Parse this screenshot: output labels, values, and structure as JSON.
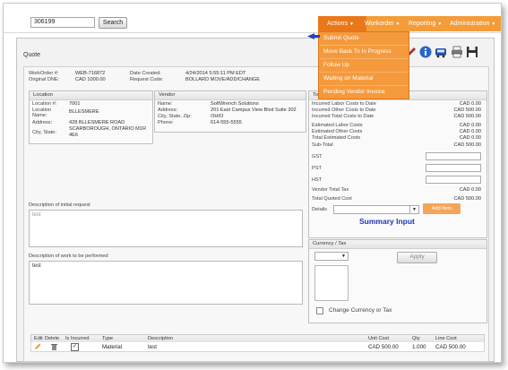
{
  "search": {
    "value": "306199",
    "button": "Search"
  },
  "menubar": {
    "items": [
      {
        "label": "Actions"
      },
      {
        "label": "Workorder"
      },
      {
        "label": "Reporting"
      },
      {
        "label": "Administration"
      }
    ]
  },
  "dropdown": {
    "items": [
      "Submit Quote",
      "Move Back To In Progress",
      "Follow Up",
      "Waiting on Material",
      "Pending Vendor Invoice"
    ]
  },
  "panel": {
    "title": "Quote"
  },
  "header": {
    "workorder_label": "WorkOrder #:",
    "workorder_value": "WEB-716872",
    "original_nte_label": "Original DNE:",
    "original_nte_value": "CAD 1000.00",
    "date_created_label": "Date Created:",
    "date_created_value": "4/24/2014 5:55:11 PM EDT",
    "request_code_label": "Request Code:",
    "request_code_value": "BOLLARD MOVE/ADD/CHANGE",
    "extra_1": "D",
    "extra_2": "D"
  },
  "location": {
    "title": "Location",
    "number_label": "Location #:",
    "number_value": "7001",
    "name_label": "Location Name:",
    "name_label_1": "Location",
    "name_label_2": "Name:",
    "name_value": "BLLESMERE",
    "address_label": "Address:",
    "address_value": "428 BLLESMERE ROAD",
    "city_label": "City, State:",
    "city_value_1": "SCARBOROUGH, ONTARIO M1R",
    "city_value_2": "4E6"
  },
  "vendor": {
    "title": "Vendor",
    "name_label": "Name:",
    "name_value": "SoftWrench Solutions",
    "address_label": "Address:",
    "address_value": "201 East Campus View Blvd Suite 302",
    "city_label": "City, State, Zip:",
    "city_value": "OHIO",
    "phone_label": "Phone:",
    "phone_value": "614-555-5555"
  },
  "totals": {
    "title": "Totals",
    "rows": [
      {
        "label": "Incurred Labor Costs to Date",
        "value": "CAD 0.00"
      },
      {
        "label": "Incurred Other Costs to Date",
        "value": "CAD 500.00"
      },
      {
        "label": "Incurred Total Costs to Date",
        "value": "CAD 500.00"
      },
      {
        "label": "Estimated Labor Costs",
        "value": "CAD 0.00"
      },
      {
        "label": "Estimated Other Costs",
        "value": "CAD 0.00"
      },
      {
        "label": "Total Estimated Costs",
        "value": "CAD 0.00"
      },
      {
        "label": "Sub-Total",
        "value": "CAD 500.00"
      }
    ],
    "gst_label": "GST",
    "pst_label": "PST",
    "hst_label": "HST",
    "vendor_tax_label": "Vendor Total Tax",
    "vendor_tax_value": "CAD 0.00",
    "total_quoted_label": "Total Quoted Cost",
    "total_quoted_value": "CAD 500.00",
    "details_label": "Details",
    "add_button": "Add Item"
  },
  "annotation": {
    "summary_input": "Summary Input"
  },
  "currency": {
    "title": "Currency / Tax",
    "apply_button": "Apply",
    "change_label": "Change Currency or Tax"
  },
  "initial_request": {
    "label": "Description of initial request",
    "value": "test"
  },
  "work_performed": {
    "label": "Description of work to be performed",
    "value": "test"
  },
  "table": {
    "headers": [
      "Edit",
      "Delete",
      "Is Incurred",
      "Type",
      "Description",
      "Unit Cost",
      "Qty",
      "Line Cost"
    ],
    "rows": [
      {
        "type": "Material",
        "description": "test",
        "unit_cost": "CAD 500.00",
        "qty": "1.000",
        "line_cost": "CAD 500.00"
      }
    ]
  },
  "colors": {
    "menu_orange": "#f39c3a",
    "menu_dark_orange": "#e8781a",
    "summary_blue": "#1d35b8"
  }
}
